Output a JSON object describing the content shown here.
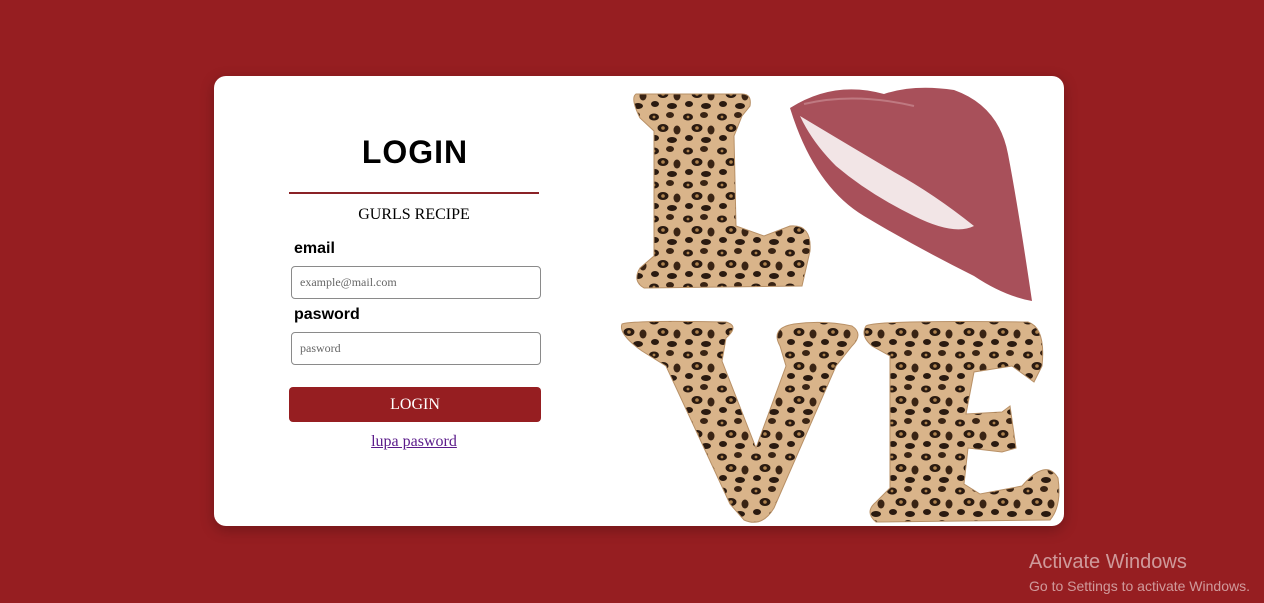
{
  "login": {
    "title": "LOGIN",
    "subtitle": "GURLS RECIPE",
    "email_label": "email",
    "email_placeholder": "example@mail.com",
    "password_label": "pasword",
    "password_placeholder": "pasword",
    "button_label": "LOGIN",
    "forgot_link": "lupa pasword"
  },
  "artwork": {
    "letters": [
      "L",
      "O",
      "V",
      "E"
    ],
    "o_replacement": "lips-print",
    "pattern": "leopard-print"
  },
  "watermark": {
    "title": "Activate Windows",
    "subtitle": "Go to Settings to activate Windows."
  },
  "colors": {
    "background": "#961e21",
    "button": "#961e21",
    "card": "#ffffff",
    "divider": "#8a2226",
    "link": "#5a1a8a",
    "lips": "#a8505a",
    "leopard_base": "#d9b48a",
    "leopard_spots": "#2a1a10"
  }
}
